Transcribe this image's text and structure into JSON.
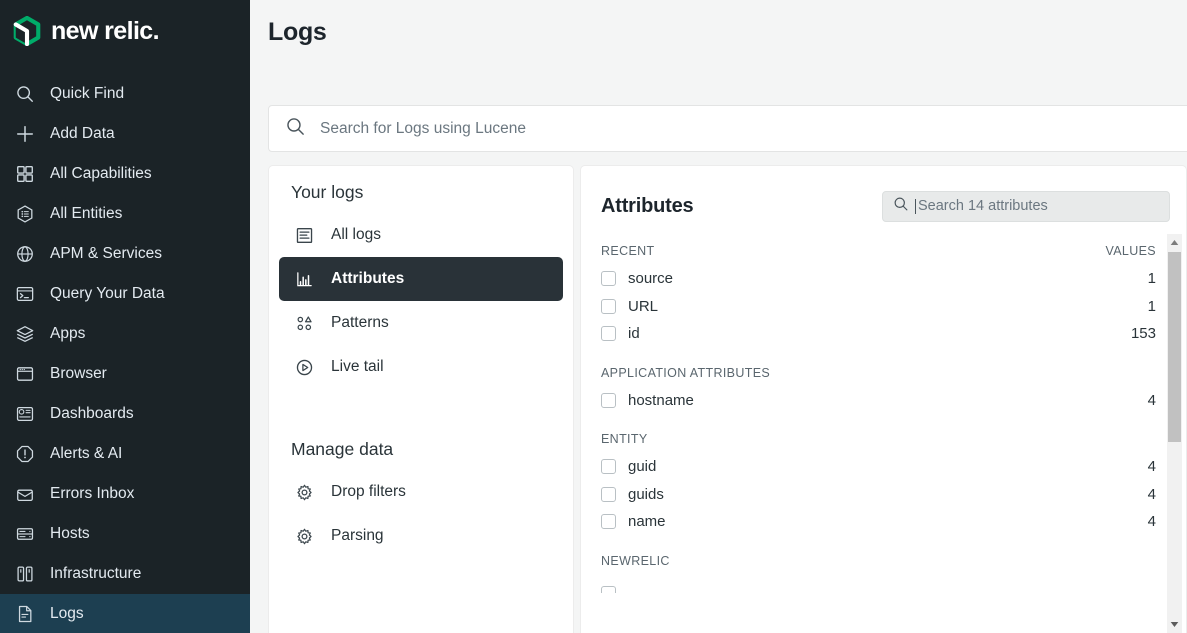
{
  "brand": {
    "name": "new relic.",
    "logo_icon": "newrelic-cube-icon",
    "accent_color": "#00ac69",
    "sidebar_bg": "#1b2327",
    "active_bg": "#1d3f51"
  },
  "sidebar": {
    "items": [
      {
        "label": "Quick Find",
        "icon": "search-icon",
        "active": false
      },
      {
        "label": "Add Data",
        "icon": "plus-icon",
        "active": false
      },
      {
        "label": "All Capabilities",
        "icon": "grid-icon",
        "active": false
      },
      {
        "label": "All Entities",
        "icon": "hexagon-list-icon",
        "active": false
      },
      {
        "label": "APM & Services",
        "icon": "globe-icon",
        "active": false
      },
      {
        "label": "Query Your Data",
        "icon": "terminal-icon",
        "active": false
      },
      {
        "label": "Apps",
        "icon": "layers-icon",
        "active": false
      },
      {
        "label": "Browser",
        "icon": "browser-window-icon",
        "active": false
      },
      {
        "label": "Dashboards",
        "icon": "dashboard-icon",
        "active": false
      },
      {
        "label": "Alerts & AI",
        "icon": "alert-octagon-icon",
        "active": false
      },
      {
        "label": "Errors Inbox",
        "icon": "inbox-icon",
        "active": false
      },
      {
        "label": "Hosts",
        "icon": "server-icon",
        "active": false
      },
      {
        "label": "Infrastructure",
        "icon": "infrastructure-icon",
        "active": false
      },
      {
        "label": "Logs",
        "icon": "document-icon",
        "active": true
      }
    ]
  },
  "header": {
    "title": "Logs"
  },
  "lucene_search": {
    "placeholder": "Search for Logs using Lucene",
    "value": "",
    "icon": "search-icon"
  },
  "left_panel": {
    "your_logs": {
      "title": "Your logs",
      "items": [
        {
          "label": "All logs",
          "icon": "list-document-icon",
          "active": false
        },
        {
          "label": "Attributes",
          "icon": "bar-chart-icon",
          "active": true
        },
        {
          "label": "Patterns",
          "icon": "shapes-icon",
          "active": false
        },
        {
          "label": "Live tail",
          "icon": "play-circle-icon",
          "active": false
        }
      ]
    },
    "manage_data": {
      "title": "Manage data",
      "items": [
        {
          "label": "Drop filters",
          "icon": "gear-icon",
          "active": false
        },
        {
          "label": "Parsing",
          "icon": "gear-icon",
          "active": false
        }
      ]
    }
  },
  "attributes_panel": {
    "title": "Attributes",
    "search": {
      "placeholder": "Search 14 attributes",
      "value": "",
      "icon": "search-icon"
    },
    "columns": {
      "name_header": "RECENT",
      "values_header": "VALUES"
    },
    "groups": [
      {
        "name": "RECENT",
        "values_header": "VALUES",
        "rows": [
          {
            "name": "source",
            "values": "1",
            "checked": false
          },
          {
            "name": "URL",
            "values": "1",
            "checked": false
          },
          {
            "name": "id",
            "values": "153",
            "checked": false
          }
        ]
      },
      {
        "name": "APPLICATION ATTRIBUTES",
        "values_header": "",
        "rows": [
          {
            "name": "hostname",
            "values": "4",
            "checked": false
          }
        ]
      },
      {
        "name": "ENTITY",
        "values_header": "",
        "rows": [
          {
            "name": "guid",
            "values": "4",
            "checked": false
          },
          {
            "name": "guids",
            "values": "4",
            "checked": false
          },
          {
            "name": "name",
            "values": "4",
            "checked": false
          }
        ]
      },
      {
        "name": "NEWRELIC",
        "values_header": "",
        "rows": []
      }
    ],
    "scrollbar": {
      "up_icon": "caret-up-icon",
      "down_icon": "caret-down-icon"
    }
  }
}
